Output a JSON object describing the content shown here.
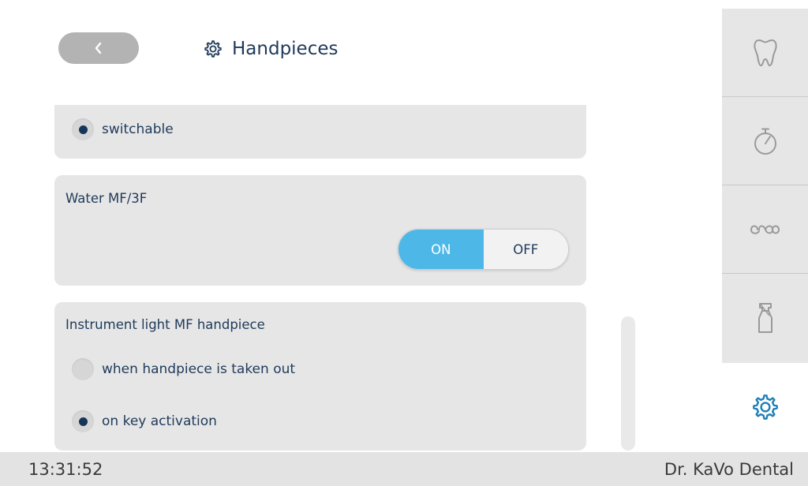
{
  "header": {
    "back_icon": "chevron-left-icon",
    "title_icon": "gear-icon",
    "title": "Handpieces"
  },
  "sections": {
    "top": {
      "option_label": "switchable",
      "option_selected": true
    },
    "water": {
      "title": "Water MF/3F",
      "toggle_on_label": "ON",
      "toggle_off_label": "OFF",
      "toggle_state": "ON"
    },
    "light": {
      "title": "Instrument light MF handpiece",
      "options": [
        {
          "label": "when handpiece is taken out",
          "selected": false
        },
        {
          "label": "on key activation",
          "selected": true
        }
      ]
    }
  },
  "sidebar": {
    "items": [
      {
        "icon": "tooth-icon"
      },
      {
        "icon": "stopwatch-icon"
      },
      {
        "icon": "infinity-loop-icon"
      },
      {
        "icon": "spray-bottle-icon"
      }
    ],
    "active_item": {
      "icon": "gear-icon"
    }
  },
  "footer": {
    "time": "13:31:52",
    "user": "Dr. KaVo Dental"
  },
  "colors": {
    "accent": "#4db8e8",
    "text": "#1f3a5a",
    "panel": "#e6e6e6",
    "radio_dot": "#163659"
  }
}
